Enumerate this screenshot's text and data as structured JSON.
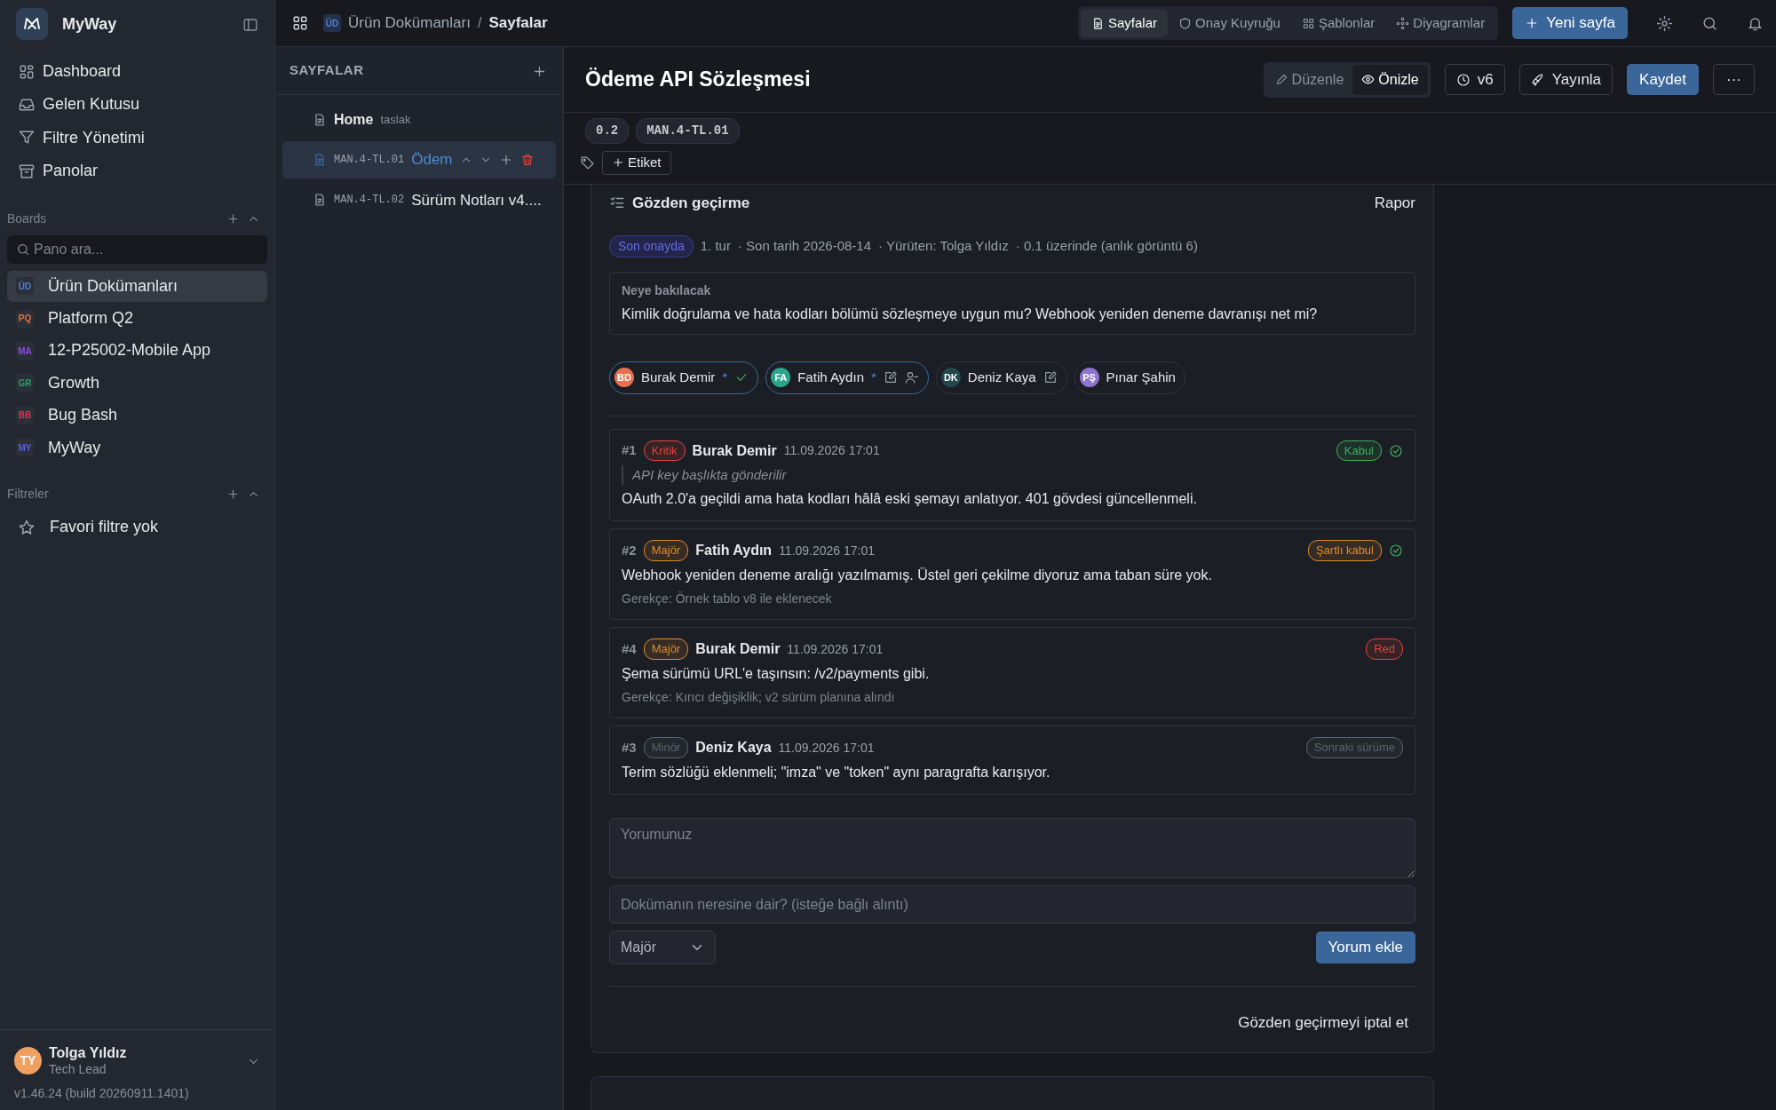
{
  "sidebar": {
    "brand": "MyWay",
    "nav": [
      {
        "label": "Dashboard",
        "kind": "dashboard"
      },
      {
        "label": "Gelen Kutusu",
        "kind": "inbox"
      },
      {
        "label": "Filtre Yönetimi",
        "kind": "filter"
      },
      {
        "label": "Panolar",
        "kind": "archive"
      }
    ],
    "boards": {
      "title": "Boards",
      "search_placeholder": "Pano ara...",
      "items": [
        {
          "initials": "ÜD",
          "label": "Ürün Dokümanları",
          "color": "#4d7fd1",
          "selected": true
        },
        {
          "initials": "PQ",
          "label": "Platform Q2",
          "color": "#e2763c",
          "selected": false
        },
        {
          "initials": "MA",
          "label": "12-P25002-Mobile App",
          "color": "#8a4fe0",
          "selected": false
        },
        {
          "initials": "GR",
          "label": "Growth",
          "color": "#2f9e6a",
          "selected": false
        },
        {
          "initials": "BB",
          "label": "Bug Bash",
          "color": "#d9364e",
          "selected": false
        },
        {
          "initials": "MY",
          "label": "MyWay",
          "color": "#5a5ee0",
          "selected": false
        }
      ]
    },
    "filters": {
      "title": "Filtreler",
      "empty": "Favori filtre yok"
    },
    "user": {
      "initials": "TY",
      "name": "Tolga Yıldız",
      "role": "Tech Lead",
      "version": "v1.46.24 (build 20260911.1401)"
    }
  },
  "breadcrumb": {
    "badge": "ÜD",
    "project": "Ürün Dokümanları",
    "separator": "/",
    "current": "Sayfalar"
  },
  "top_tabs": [
    {
      "label": "Sayfalar",
      "kind": "doc",
      "selected": true
    },
    {
      "label": "Onay Kuyruğu",
      "kind": "shield",
      "selected": false
    },
    {
      "label": "Şablonlar",
      "kind": "grid",
      "selected": false
    },
    {
      "label": "Diyagramlar",
      "kind": "diagram",
      "selected": false
    }
  ],
  "new_page_button": "Yeni sayfa",
  "pages_panel": {
    "title": "SAYFALAR",
    "pages": [
      {
        "title": "Home",
        "tag": "taslak",
        "selected": false
      },
      {
        "code": "MAN.4-TL.01",
        "title": "Ödem",
        "selected": true
      },
      {
        "code": "MAN.4-TL.02",
        "title": "Sürüm Notları v4....",
        "selected": false
      }
    ]
  },
  "document": {
    "title": "Ödeme API Sözleşmesi",
    "modes": [
      {
        "label": "Düzenle",
        "kind": "pencil",
        "selected": false
      },
      {
        "label": "Önizle",
        "kind": "eye",
        "selected": true
      }
    ],
    "version_button": "v6",
    "publish_button": "Yayınla",
    "save_button": "Kaydet",
    "more_button": "···",
    "chips": [
      "0.2",
      "MAN.4-TL.01"
    ],
    "tag_button": "Etiket"
  },
  "review": {
    "title": "Gözden geçirme",
    "report_link": "Rapor",
    "status": "Son onayda",
    "meta": [
      "1. tur",
      "· Son tarih 2026-08-14",
      "· Yürüten: Tolga Yıldız",
      "· 0.1 üzerinde (anlık görüntü 6)"
    ],
    "question_label": "Neye bakılacak",
    "question": "Kimlik doğrulama ve hata kodları bölümü sözleşmeye uygun mu? Webhook yeniden deneme davranışı net mi?",
    "reviewers": [
      {
        "initials": "BD",
        "name": "Burak Demir",
        "color": "#e8704f",
        "mark": "*",
        "active": true,
        "approved": true,
        "editing": false,
        "removable": false
      },
      {
        "initials": "FA",
        "name": "Fatih Aydın",
        "color": "#2aa58a",
        "mark": "*",
        "active": true,
        "approved": false,
        "editing": true,
        "removable": true
      },
      {
        "initials": "DK",
        "name": "Deniz Kaya",
        "color": "#22474d",
        "active": false,
        "approved": false,
        "editing": true,
        "removable": false
      },
      {
        "initials": "PŞ",
        "name": "Pınar Şahin",
        "color": "#8d74d0",
        "active": false,
        "approved": false,
        "editing": false,
        "removable": false
      }
    ],
    "comments": [
      {
        "number": "#1",
        "severity": {
          "label": "Kritik",
          "color": "#e0443e"
        },
        "author": "Burak Demir",
        "time": "11.09.2026 17:01",
        "quote": "API key başlıkta gönderilir",
        "body": "OAuth 2.0'a geçildi ama hata kodları hâlâ eski şemayı anlatıyor. 401 gövdesi güncellenmeli.",
        "resolution": {
          "label": "Kabul",
          "color": "#3fae5c"
        },
        "resolved": true
      },
      {
        "number": "#2",
        "severity": {
          "label": "Majör",
          "color": "#e08a2b"
        },
        "author": "Fatih Aydın",
        "time": "11.09.2026 17:01",
        "body": "Webhook yeniden deneme aralığı yazılmamış. Üstel geri çekilme diyoruz ama taban süre yok.",
        "rationale": "Gerekçe: Örnek tablo v8 ile eklenecek",
        "resolution": {
          "label": "Şartlı kabul",
          "color": "#e08a2b"
        },
        "resolved": true
      },
      {
        "number": "#4",
        "severity": {
          "label": "Majör",
          "color": "#e08a2b"
        },
        "author": "Burak Demir",
        "time": "11.09.2026 17:01",
        "body": "Şema sürümü URL'e taşınsın: /v2/payments gibi.",
        "rationale": "Gerekçe: Kırıcı değişiklik; v2 sürüm planına alındı",
        "resolution": {
          "label": "Red",
          "color": "#e0443e"
        },
        "resolved": false
      },
      {
        "number": "#3",
        "severity": {
          "label": "Minör",
          "color": "#5c6370"
        },
        "author": "Deniz Kaya",
        "time": "11.09.2026 17:01",
        "body": "Terim sözlüğü eklenmeli; \"imza\" ve \"token\" aynı paragrafta karışıyor.",
        "resolution": {
          "label": "Sonraki sürüme",
          "color": "#5c6370"
        },
        "resolved": false
      }
    ],
    "comment_placeholder": "Yorumunuz",
    "quote_placeholder": "Dokümanın neresine dair? (isteğe bağlı alıntı)",
    "severity_select": "Majör",
    "add_button": "Yorum ekle",
    "cancel_link": "Gözden geçirmeyi iptal et"
  }
}
